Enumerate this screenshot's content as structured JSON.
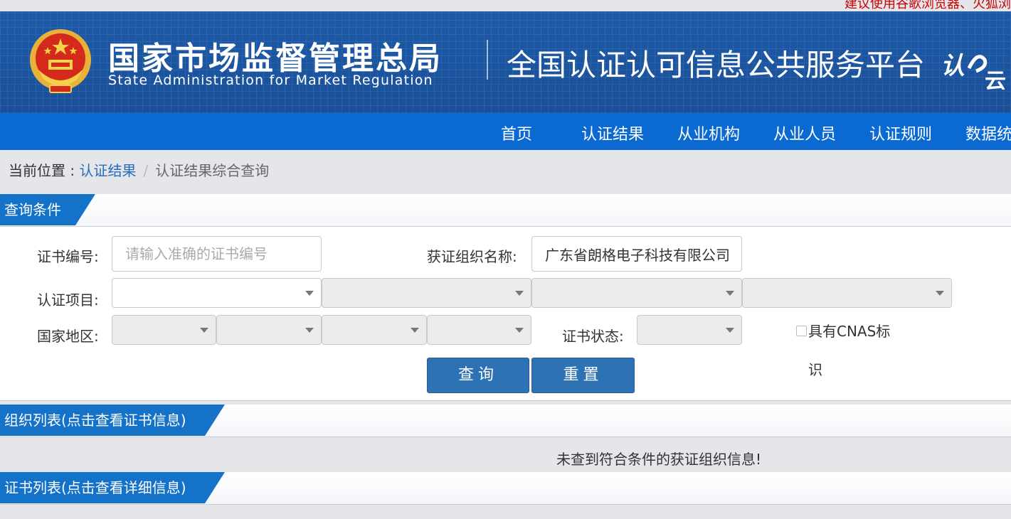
{
  "topbar": {
    "note": "建议使用谷歌浏览器、火狐浏"
  },
  "header": {
    "agency_cn": "国家市场监督管理总局",
    "agency_en": "State Administration  for  Market Regulation",
    "platform_name": "全国认证认可信息公共服务平台",
    "logo_text": "认云"
  },
  "nav": {
    "items": [
      {
        "label": "首页"
      },
      {
        "label": "认证结果"
      },
      {
        "label": "从业机构"
      },
      {
        "label": "从业人员"
      },
      {
        "label": "认证规则"
      },
      {
        "label": "数据统"
      }
    ]
  },
  "breadcrumb": {
    "prefix": "当前位置 : ",
    "link": "认证结果",
    "separator": "/",
    "current": "认证结果综合查询"
  },
  "query": {
    "section_title": "查询条件",
    "cert_no_label": "证书编号:",
    "cert_no_placeholder": "请输入准确的证书编号",
    "org_name_label": "获证组织名称:",
    "org_name_value": "广东省朗格电子科技有限公司",
    "cert_item_label": "认证项目:",
    "region_label": "国家地区:",
    "cert_status_label": "证书状态:",
    "cnas_label": "具有CNAS标识",
    "search_button": "查询",
    "reset_button": "重置"
  },
  "org_list": {
    "section_title": "组织列表(点击查看证书信息)",
    "empty_message": "未查到符合条件的获证组织信息!"
  },
  "cert_list": {
    "section_title": "证书列表(点击查看详细信息)"
  },
  "colors": {
    "banner": "#1c5aa8",
    "nav": "#0a6ad2",
    "section_tab": "#1572c9",
    "button": "#2d72b5",
    "link": "#2a6bb8",
    "notice": "#cc0000"
  }
}
